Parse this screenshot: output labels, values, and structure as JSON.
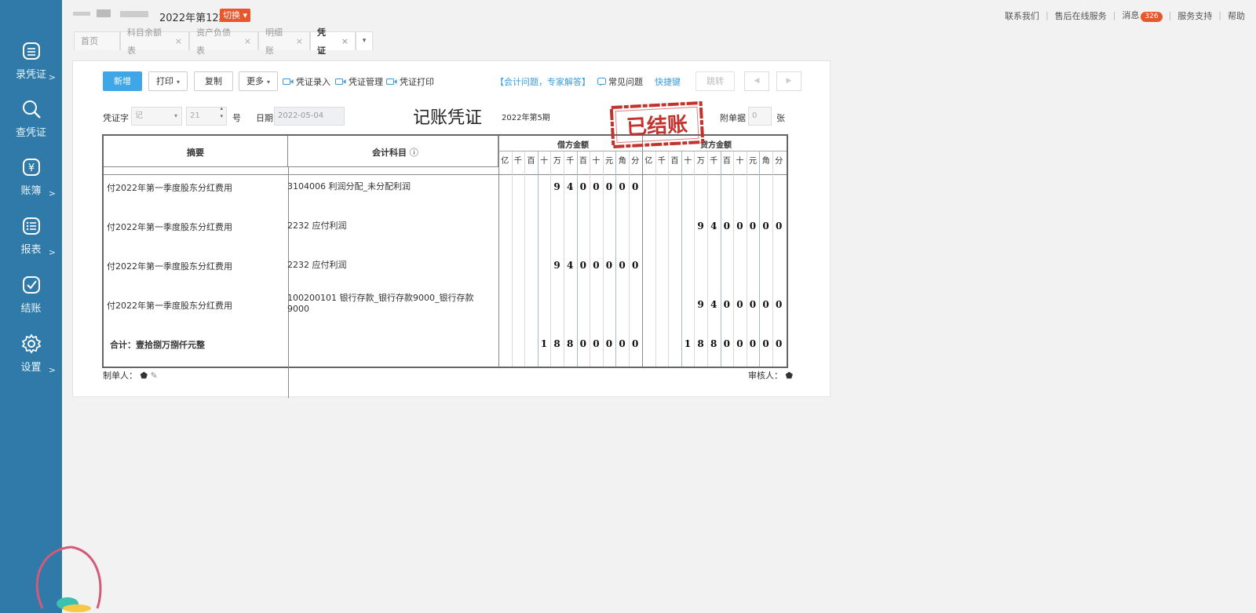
{
  "header": {
    "period": "2022年第12期",
    "switch_label": "切换",
    "links": {
      "contact": "联系我们",
      "service": "售后在线服务",
      "messages": "消息",
      "message_count": "326",
      "support": "服务支持",
      "help": "帮助"
    }
  },
  "sidebar": {
    "items": [
      {
        "label": "录凭证",
        "arrow": ">"
      },
      {
        "label": "查凭证",
        "arrow": ""
      },
      {
        "label": "账簿",
        "arrow": ">"
      },
      {
        "label": "报表",
        "arrow": ">"
      },
      {
        "label": "结账",
        "arrow": ""
      },
      {
        "label": "设置",
        "arrow": ">"
      }
    ]
  },
  "tabs": [
    {
      "label": "首页",
      "closable": false
    },
    {
      "label": "科目余额表",
      "closable": true
    },
    {
      "label": "资产负债表",
      "closable": true
    },
    {
      "label": "明细账",
      "closable": true
    },
    {
      "label": "凭证",
      "closable": true
    }
  ],
  "toolbar": {
    "new": "新增",
    "print": "打印",
    "copy": "复制",
    "more": "更多",
    "entry_video": "凭证录入",
    "manage_video": "凭证管理",
    "print_video": "凭证打印",
    "expert": "【会计问题，专家解答】",
    "faq": "常见问题",
    "shortcut": "快捷键",
    "jump": "跳转"
  },
  "voucher": {
    "word_label": "凭证字",
    "word_value": "记",
    "number_value": "21",
    "number_suffix": "号",
    "date_label": "日期",
    "date_value": "2022-05-04",
    "title": "记账凭证",
    "period": "2022年第5期",
    "stamp": "已结账",
    "attach_label": "附单据",
    "attach_value": "0",
    "attach_unit": "张"
  },
  "table": {
    "col_summary": "摘要",
    "col_account": "会计科目",
    "col_debit": "借方金额",
    "col_credit": "贷方金额",
    "digit_units": [
      "亿",
      "千",
      "百",
      "十",
      "万",
      "千",
      "百",
      "十",
      "元",
      "角",
      "分"
    ],
    "rows": [
      {
        "summary": "付2022年第一季度股东分红费用",
        "account": "3104006 利润分配_未分配利润",
        "debit": "9400000",
        "credit": ""
      },
      {
        "summary": "付2022年第一季度股东分红费用",
        "account": "2232 应付利润",
        "debit": "",
        "credit": "9400000"
      },
      {
        "summary": "付2022年第一季度股东分红费用",
        "account": "2232 应付利润",
        "debit": "9400000",
        "credit": ""
      },
      {
        "summary": "付2022年第一季度股东分红费用",
        "account": "100200101 银行存款_银行存款9000_银行存款9000",
        "debit": "",
        "credit": "9400000"
      }
    ],
    "total_label": "合计：壹拾捌万捌仟元整",
    "total_debit": "18800000",
    "total_credit": "18800000"
  },
  "footer": {
    "maker_label": "制单人：",
    "reviewer_label": "审核人："
  }
}
